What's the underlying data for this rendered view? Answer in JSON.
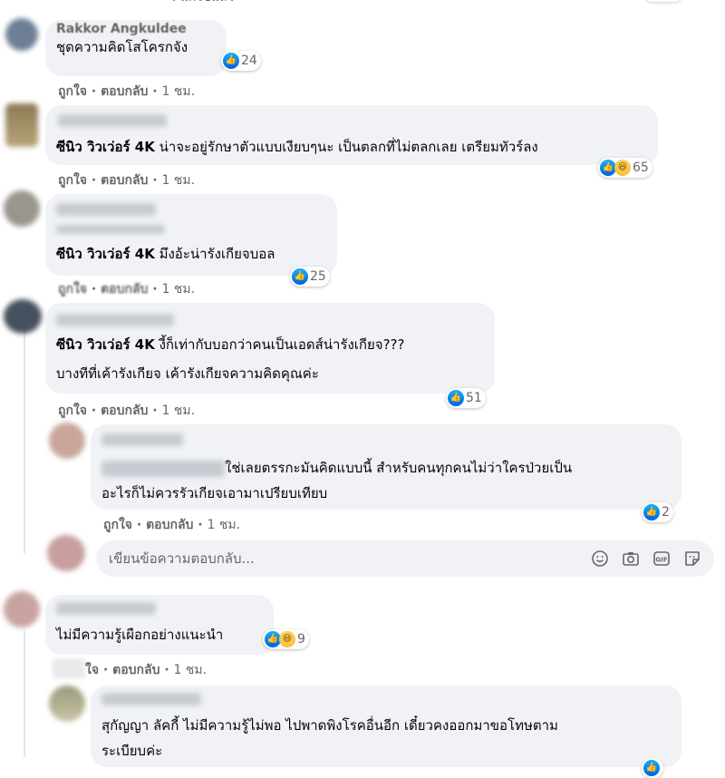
{
  "top_fragment": {
    "text": ". แก่ไข่แล้ว"
  },
  "comments": [
    {
      "author": "Rakkor Angkuldee",
      "mention": "",
      "text": "ชุดความคิดโสโครกจัง",
      "reaction_count": "24",
      "actions": {
        "like": "ถูกใจ",
        "reply": "ตอบกลับ",
        "time": "1 ชม."
      }
    },
    {
      "author": "",
      "mention": "ซีนิว วิวเว่อร์ 4K",
      "text": " น่าจะอยู่รักษาตัวแบบเงียบๆนะ เป็นตลกที่ไม่ตลกเลย เตรียมทัวร์ลง",
      "reaction_count": "65",
      "actions": {
        "like": "ถูกใจ",
        "reply": "ตอบกลับ",
        "time": "1 ชม."
      }
    },
    {
      "author": "",
      "mention": "ซีนิว วิวเว่อร์ 4K",
      "text": " มึงอ้ะน่ารังเกียจบอล",
      "reaction_count": "25",
      "actions": {
        "like": "ถูกใจ",
        "reply": "ตอบกลับ",
        "time": "1 ชม."
      }
    },
    {
      "author": "",
      "mention": "ซีนิว วิวเว่อร์ 4K",
      "text": " งี้ก็เท่ากับบอกว่าคนเป็นเอดส์น่ารังเกียจ???",
      "text2": "บางทีที่เค้ารังเกียจ เค้ารังเกียจความคิดคุณค่ะ",
      "reaction_count": "51",
      "actions": {
        "like": "ถูกใจ",
        "reply": "ตอบกลับ",
        "time": "1 ชม."
      }
    },
    {
      "author": "",
      "mention": "",
      "text": "ใช่เลยตรรกะมันคิดแบบนี้ สำหรับคนทุกคนไม่ว่าใครป่วยเป็น",
      "text2": "อะไรก็ไม่ควรรัวเกียจเอามาเปรียบเทียบ",
      "reaction_count": "2",
      "actions": {
        "like": "ถูกใจ",
        "reply": "ตอบกลับ",
        "time": "1 ชม."
      }
    },
    {
      "author": "",
      "mention": "",
      "text": "ไม่มีความรู้เผือกอย่างแนะนำ",
      "reaction_count": "9",
      "actions": {
        "like": "ใจ",
        "reply": "ตอบกลับ",
        "time": "1 ชม."
      }
    },
    {
      "author": "",
      "mention": "",
      "text": "สุกัญญา ลัคกี้ ไม่มีความรู้ไม่พอ ไปพาดพิงโรคอื่นอีก เดี๋ยวคงออกมาขอโทษตาม",
      "text2": "ระเบียบค่ะ",
      "reaction_count": ""
    }
  ],
  "reply_box": {
    "placeholder": "เขียนข้อความตอบกลับ..."
  },
  "separator": " · ",
  "icons": {
    "like": "like-reaction-icon",
    "haha": "haha-reaction-icon",
    "emoji": "emoji-icon",
    "camera": "camera-icon",
    "gif": "gif-icon",
    "sticker": "sticker-icon"
  },
  "colors": {
    "bubble": "#f0f2f5",
    "like_blue": "#1877f2",
    "meta_gray": "#65676b"
  }
}
